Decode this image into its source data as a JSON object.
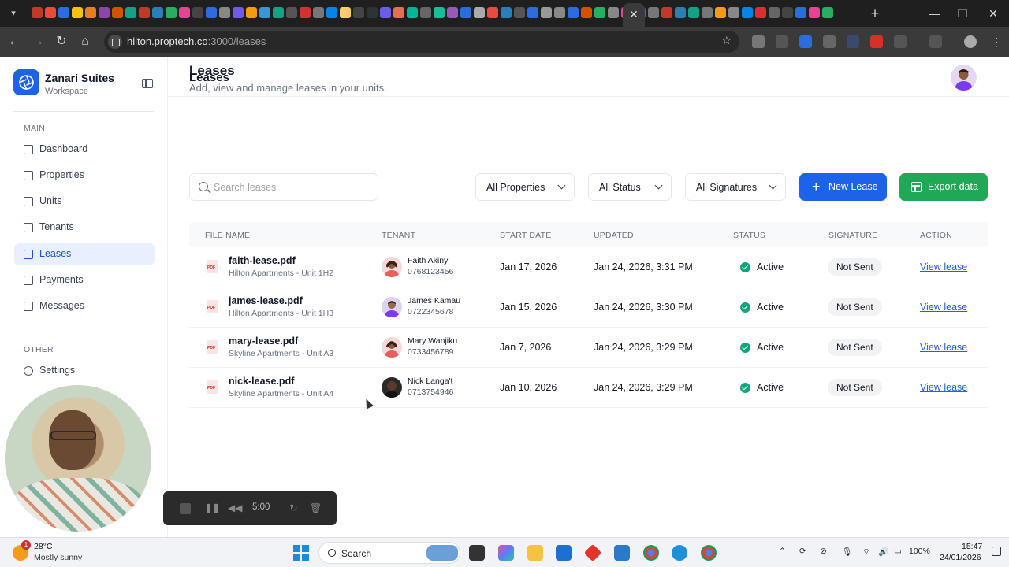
{
  "browser": {
    "url_host": "hilton.proptech.co",
    "url_path": ":3000/leases"
  },
  "app": {
    "brand_name": "Zanari Suites",
    "brand_sub": "Workspace",
    "topbar_title": "Leases"
  },
  "sidebar": {
    "section_main": "MAIN",
    "section_other": "OTHER",
    "items": [
      {
        "label": "Dashboard",
        "icon": "dashboard-icon"
      },
      {
        "label": "Properties",
        "icon": "building-icon"
      },
      {
        "label": "Units",
        "icon": "home-icon"
      },
      {
        "label": "Tenants",
        "icon": "users-icon"
      },
      {
        "label": "Leases",
        "icon": "file-icon",
        "active": true
      },
      {
        "label": "Payments",
        "icon": "credit-card-icon"
      },
      {
        "label": "Messages",
        "icon": "message-icon"
      }
    ],
    "other_items": [
      {
        "label": "Settings",
        "icon": "gear-icon"
      }
    ]
  },
  "page": {
    "title": "Leases",
    "subtitle": "Add, view and manage leases in your units."
  },
  "filters": {
    "search_placeholder": "Search leases",
    "properties": "All Properties",
    "status": "All Status",
    "signatures": "All Signatures"
  },
  "buttons": {
    "new_lease": "New Lease",
    "export": "Export data"
  },
  "table": {
    "headers": [
      "FILE NAME",
      "TENANT",
      "START DATE",
      "UPDATED",
      "STATUS",
      "SIGNATURE",
      "ACTION"
    ],
    "rows": [
      {
        "file": "faith-lease.pdf",
        "unit": "Hilton Apartments - Unit 1H2",
        "tenant": "Faith Akinyi",
        "phone": "0768123456",
        "start": "Jan 17, 2026",
        "updated": "Jan 24, 2026, 3:31 PM",
        "status": "Active",
        "signature": "Not Sent",
        "action": "View lease"
      },
      {
        "file": "james-lease.pdf",
        "unit": "Hilton Apartments - Unit 1H3",
        "tenant": "James Kamau",
        "phone": "0722345678",
        "start": "Jan 15, 2026",
        "updated": "Jan 24, 2026, 3:30 PM",
        "status": "Active",
        "signature": "Not Sent",
        "action": "View lease"
      },
      {
        "file": "mary-lease.pdf",
        "unit": "Skyline Apartments - Unit A3",
        "tenant": "Mary Wanjiku",
        "phone": "0733456789",
        "start": "Jan 7, 2026",
        "updated": "Jan 24, 2026, 3:29 PM",
        "status": "Active",
        "signature": "Not Sent",
        "action": "View lease"
      },
      {
        "file": "nick-lease.pdf",
        "unit": "Skyline Apartments - Unit A4",
        "tenant": "Nick Langa't",
        "phone": "0713754946",
        "start": "Jan 10, 2026",
        "updated": "Jan 24, 2026, 3:29 PM",
        "status": "Active",
        "signature": "Not Sent",
        "action": "View lease"
      }
    ]
  },
  "recorder": {
    "time": "5:00"
  },
  "taskbar": {
    "weather_badge": "1",
    "temperature": "28°C",
    "weather": "Mostly sunny",
    "search_label": "Search",
    "battery": "100%",
    "time": "15:47",
    "date": "24/01/2026"
  },
  "colors": {
    "primary": "#1d63ea",
    "success": "#1fa957",
    "status_active": "#10a37f"
  }
}
